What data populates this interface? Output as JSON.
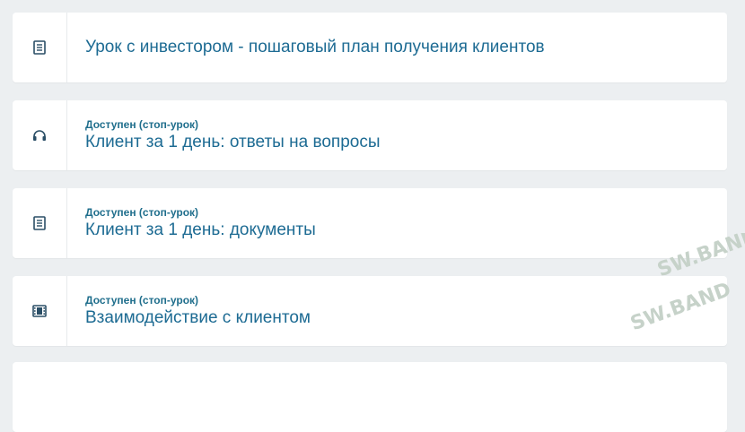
{
  "lessons": [
    {
      "status": "",
      "title": "Урок с инвестором - пошаговый план получения клиентов",
      "icon": "document-icon"
    },
    {
      "status": "Доступен (стоп-урок)",
      "title": "Клиент за 1 день: ответы на вопросы",
      "icon": "headphones-icon"
    },
    {
      "status": "Доступен (стоп-урок)",
      "title": "Клиент за 1 день: документы",
      "icon": "document-icon"
    },
    {
      "status": "Доступен (стоп-урок)",
      "title": "Взаимодействие с клиентом",
      "icon": "film-icon"
    }
  ],
  "watermark": {
    "text": "SW.BAND"
  },
  "colors": {
    "title": "#1d6b93",
    "status": "#1f6e8c",
    "background": "#eceff1",
    "watermark": "#c6d2c9"
  }
}
